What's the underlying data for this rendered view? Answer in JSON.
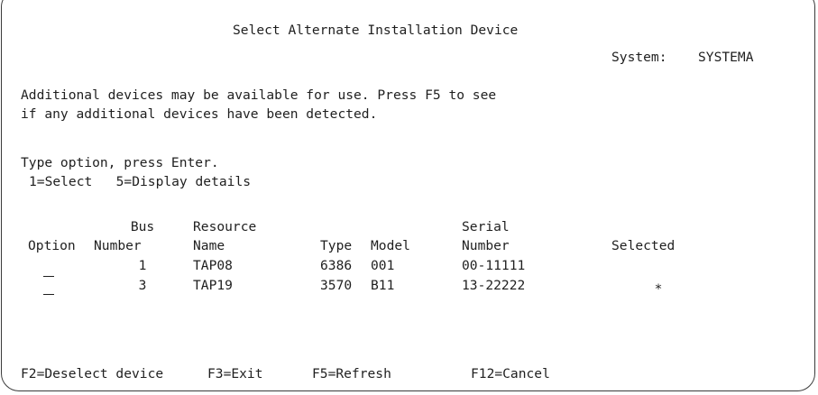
{
  "screen": {
    "title": "Select Alternate Installation Device",
    "system_label": "System:",
    "system_value": "SYSTEMA",
    "info_line1": "Additional devices may be available for use. Press F5 to see",
    "info_line2": "if any additional devices have been detected.",
    "instruction": "Type option, press Enter.",
    "options_legend": "1=Select   5=Display details"
  },
  "table": {
    "headers": {
      "option": "Option",
      "bus_1": "Bus",
      "bus_2": "Number",
      "resource_1": "Resource",
      "resource_2": "Name",
      "type": "Type",
      "model": "Model",
      "serial_1": "Serial",
      "serial_2": "Number",
      "selected": "Selected"
    },
    "rows": [
      {
        "option": "",
        "bus": "1",
        "resource": "TAP08",
        "type": "6386",
        "model": "001",
        "serial": "00-11111",
        "selected": ""
      },
      {
        "option": "",
        "bus": "3",
        "resource": "TAP19",
        "type": "3570",
        "model": "B11",
        "serial": "13-22222",
        "selected": "*"
      }
    ]
  },
  "function_keys": [
    {
      "label": "F2=Deselect device"
    },
    {
      "label": "F3=Exit"
    },
    {
      "label": "F5=Refresh"
    },
    {
      "label": "F12=Cancel"
    }
  ]
}
